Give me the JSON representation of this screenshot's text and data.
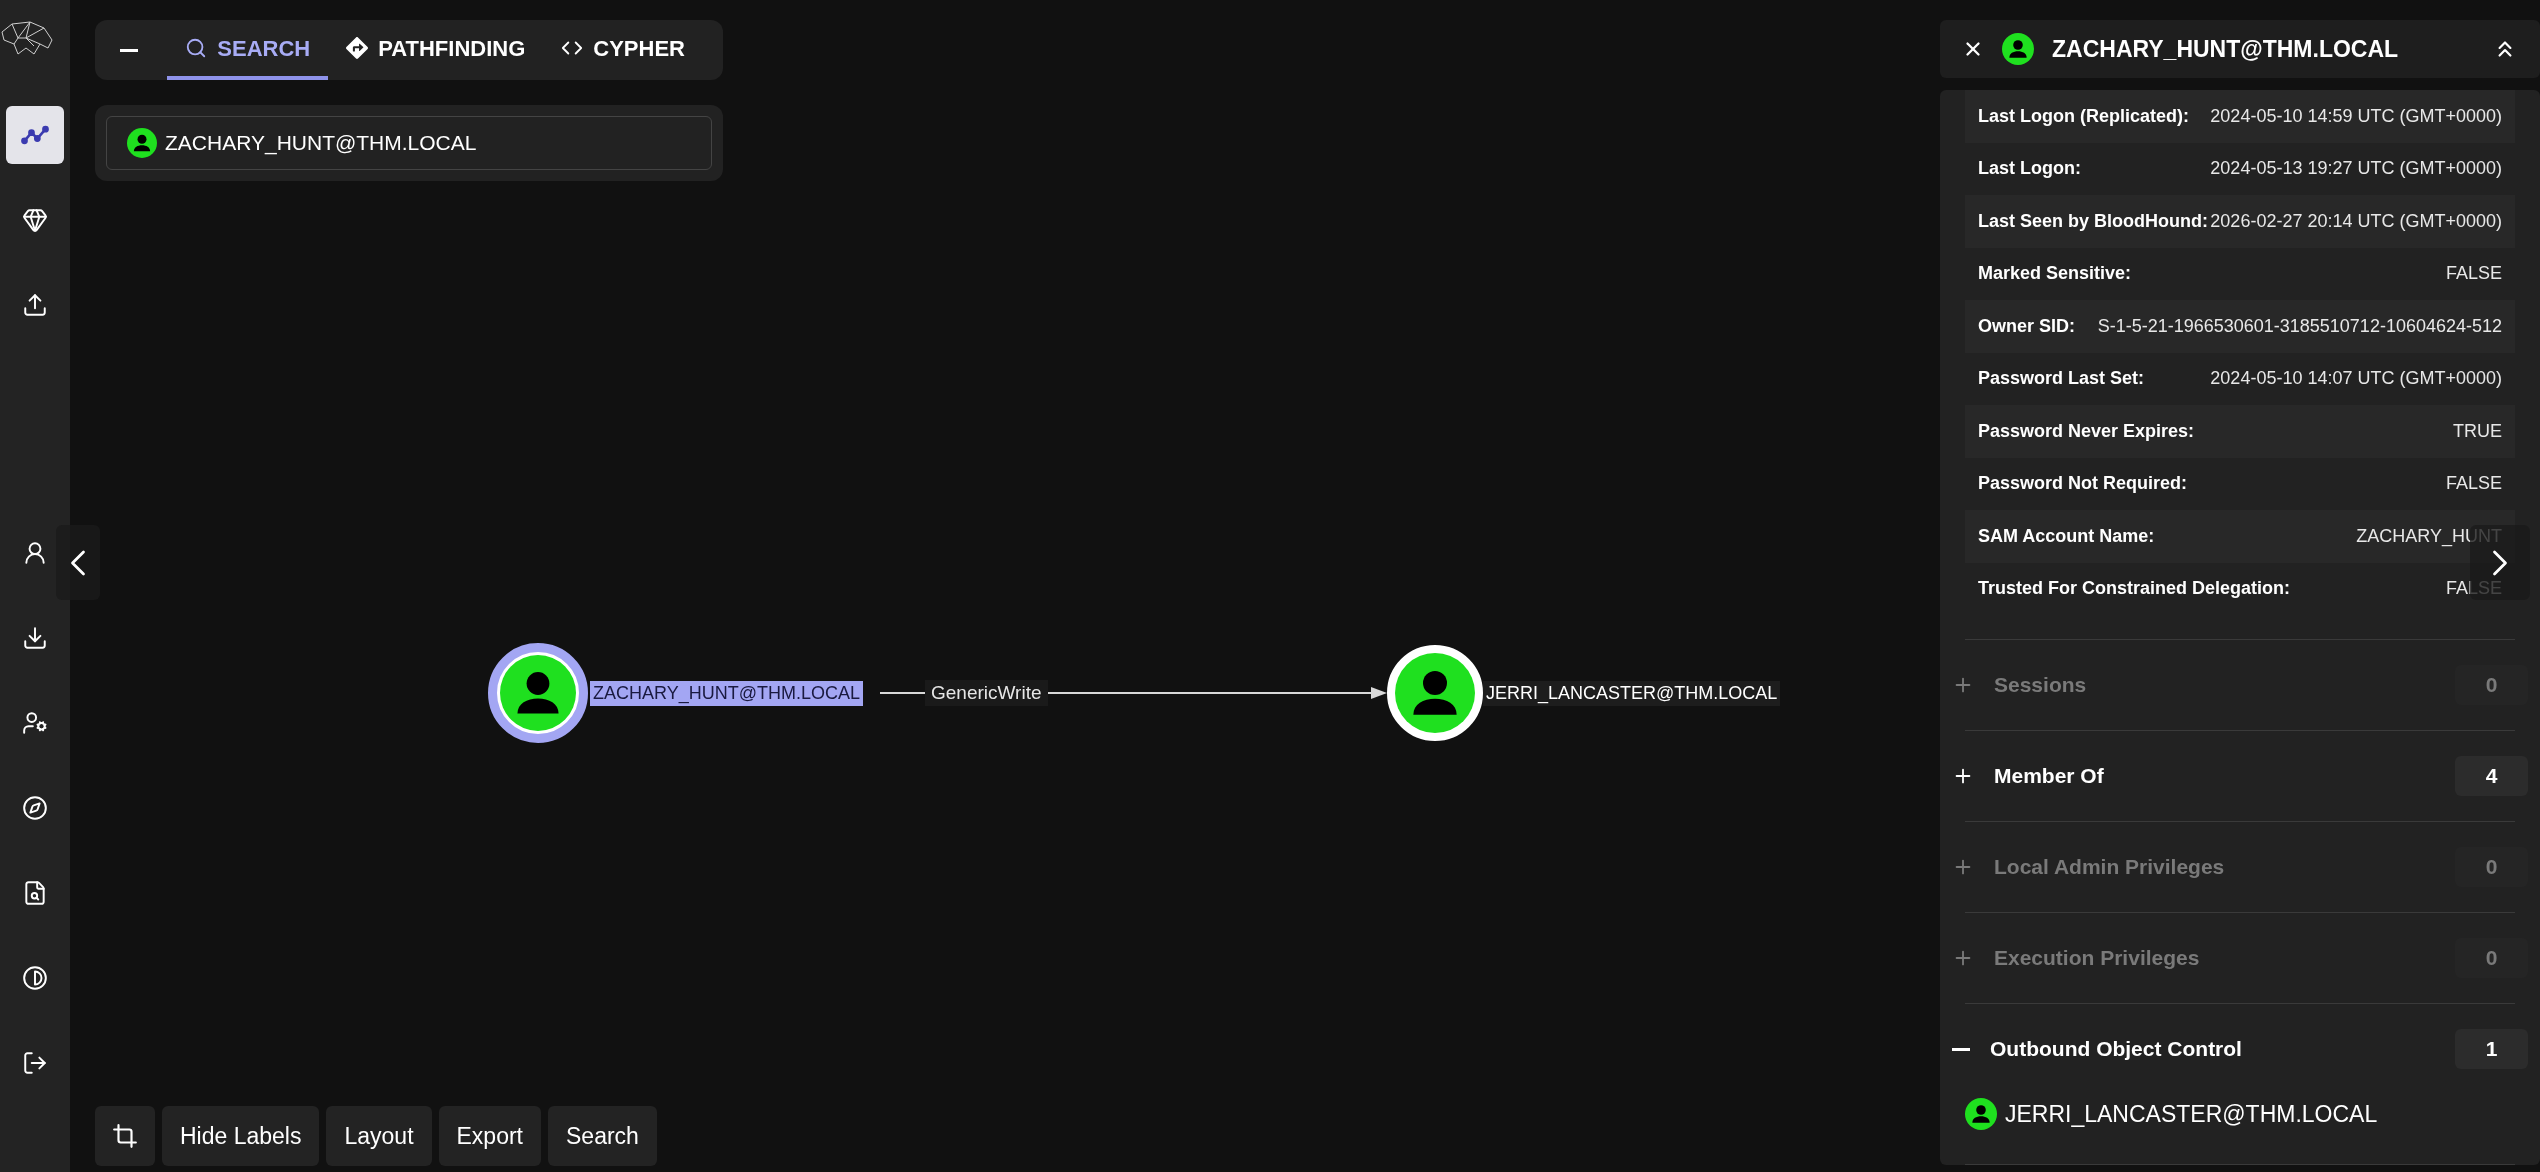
{
  "sidebar": {
    "items": [
      {
        "selected": true
      },
      {
        "selected": false
      },
      {
        "selected": false
      },
      {
        "selected": false
      },
      {
        "selected": false
      },
      {
        "selected": false
      },
      {
        "selected": false
      },
      {
        "selected": false
      },
      {
        "selected": false
      },
      {
        "selected": false
      }
    ]
  },
  "search_panel": {
    "tabs": [
      {
        "label": "SEARCH",
        "selected": true
      },
      {
        "label": "PATHFINDING",
        "selected": false
      },
      {
        "label": "CYPHER",
        "selected": false
      }
    ],
    "query": "ZACHARY_HUNT@THM.LOCAL"
  },
  "graph": {
    "nodes": [
      {
        "label": "ZACHARY_HUNT@THM.LOCAL",
        "selected": true
      },
      {
        "label": "JERRI_LANCASTER@THM.LOCAL",
        "selected": false
      }
    ],
    "edges": [
      {
        "label": "GenericWrite"
      }
    ]
  },
  "toolbar": {
    "buttons": [
      "Hide Labels",
      "Layout",
      "Export",
      "Search"
    ]
  },
  "details": {
    "title": "ZACHARY_HUNT@THM.LOCAL",
    "properties": [
      {
        "name": "Last Logon (Replicated):",
        "value": "2024-05-10 14:59 UTC (GMT+0000)"
      },
      {
        "name": "Last Logon:",
        "value": "2024-05-13 19:27 UTC (GMT+0000)"
      },
      {
        "name": "Last Seen by BloodHound:",
        "value": "2026-02-27 20:14 UTC (GMT+0000)"
      },
      {
        "name": "Marked Sensitive:",
        "value": "FALSE"
      },
      {
        "name": "Owner SID:",
        "value": "S-1-5-21-1966530601-3185510712-10604624-512"
      },
      {
        "name": "Password Last Set:",
        "value": "2024-05-10 14:07 UTC (GMT+0000)"
      },
      {
        "name": "Password Never Expires:",
        "value": "TRUE"
      },
      {
        "name": "Password Not Required:",
        "value": "FALSE"
      },
      {
        "name": "SAM Account Name:",
        "value": "ZACHARY_HUNT"
      },
      {
        "name": "Trusted For Constrained Delegation:",
        "value": "FALSE"
      }
    ],
    "sections": [
      {
        "label": "Sessions",
        "count": "0",
        "disabled": true,
        "expanded": false
      },
      {
        "label": "Member Of",
        "count": "4",
        "disabled": false,
        "expanded": false
      },
      {
        "label": "Local Admin Privileges",
        "count": "0",
        "disabled": true,
        "expanded": false
      },
      {
        "label": "Execution Privileges",
        "count": "0",
        "disabled": true,
        "expanded": false
      },
      {
        "label": "Outbound Object Control",
        "count": "1",
        "disabled": false,
        "expanded": true,
        "children": [
          {
            "label": "JERRI_LANCASTER@THM.LOCAL"
          }
        ]
      }
    ]
  }
}
